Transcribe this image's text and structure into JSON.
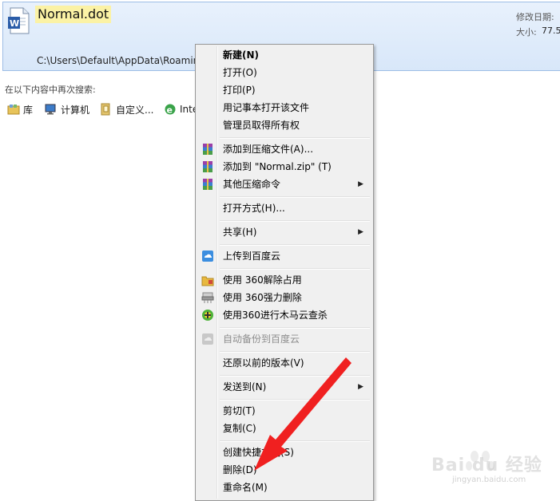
{
  "result": {
    "file_name": "Normal.dot",
    "path": "C:\\Users\\Default\\AppData\\Roaming\\Microsoft\\Templates",
    "modified_label": "修改日期:",
    "size_label": "大小:",
    "size_value": "77.5"
  },
  "search_again": {
    "label": "在以下内容中再次搜索:",
    "locations": [
      {
        "label": "库",
        "icon": "library-icon"
      },
      {
        "label": "计算机",
        "icon": "computer-icon"
      },
      {
        "label": "自定义...",
        "icon": "custom-folder-icon"
      },
      {
        "label": "Inte",
        "icon": "internet-explorer-icon"
      }
    ]
  },
  "menu": {
    "items": [
      {
        "label": "新建(N)"
      },
      {
        "label": "打开(O)"
      },
      {
        "label": "打印(P)"
      },
      {
        "label": "用记事本打开该文件"
      },
      {
        "label": "管理员取得所有权"
      },
      {
        "label": "添加到压缩文件(A)...",
        "icon": "winrar-icon"
      },
      {
        "label": "添加到 \"Normal.zip\" (T)",
        "icon": "winrar-icon"
      },
      {
        "label": "其他压缩命令",
        "icon": "winrar-icon"
      },
      {
        "label": "打开方式(H)..."
      },
      {
        "label": "共享(H)"
      },
      {
        "label": "上传到百度云",
        "icon": "baidu-cloud-icon"
      },
      {
        "label": "使用 360解除占用",
        "icon": "unlock-folder-icon"
      },
      {
        "label": "使用 360强力删除",
        "icon": "shredder-icon"
      },
      {
        "label": "使用360进行木马云查杀",
        "icon": "360-scan-icon"
      },
      {
        "label": "自动备份到百度云",
        "icon": "baidu-backup-icon"
      },
      {
        "label": "还原以前的版本(V)"
      },
      {
        "label": "发送到(N)"
      },
      {
        "label": "剪切(T)"
      },
      {
        "label": "复制(C)"
      },
      {
        "label": "创建快捷方式(S)"
      },
      {
        "label": "删除(D)"
      },
      {
        "label": "重命名(M)"
      }
    ]
  },
  "watermark": {
    "brand": "Bai du 经验",
    "url": "jingyan.baidu.com"
  },
  "colors": {
    "selection_bg": "#dce9f9",
    "title_highlight": "#fbf2a5",
    "menu_bg": "#f0f0f0",
    "annotation_arrow": "#f02020"
  }
}
